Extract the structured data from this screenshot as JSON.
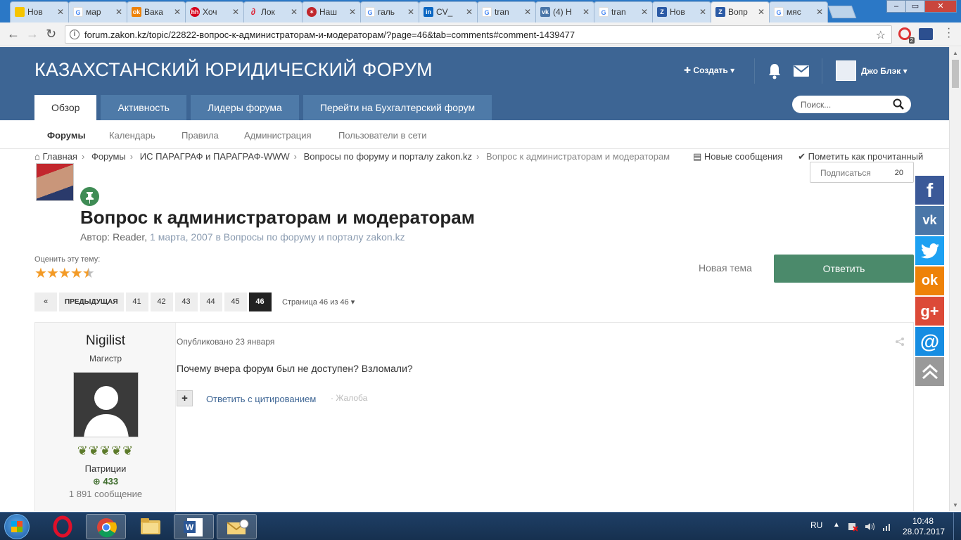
{
  "browser": {
    "tabs": [
      {
        "label": "Нов",
        "icon": "yandex",
        "color": "#f5c400"
      },
      {
        "label": "мар",
        "icon": "google",
        "color": "#4285f4"
      },
      {
        "label": "Вака",
        "icon": "odnoklassniki",
        "color": "#ee8208"
      },
      {
        "label": "Хоч",
        "icon": "hh",
        "color": "#d6001c"
      },
      {
        "label": "Лок",
        "icon": "paperclip",
        "color": "#d23"
      },
      {
        "label": "Наш",
        "icon": "red-circle",
        "color": "#c0262c"
      },
      {
        "label": "галь",
        "icon": "google",
        "color": "#4285f4"
      },
      {
        "label": "CV_",
        "icon": "linkedin",
        "color": "#0a66c2"
      },
      {
        "label": "tran",
        "icon": "google",
        "color": "#4285f4"
      },
      {
        "label": "(4) Н",
        "icon": "vk",
        "color": "#4a76a8"
      },
      {
        "label": "tran",
        "icon": "google",
        "color": "#4285f4"
      },
      {
        "label": "Нов",
        "icon": "zakon",
        "color": "#2b5aa5"
      },
      {
        "label": "Вопр",
        "icon": "zakon",
        "color": "#2b5aa5",
        "active": true
      },
      {
        "label": "мяс",
        "icon": "google",
        "color": "#4285f4"
      }
    ],
    "url": "forum.zakon.kz/topic/22822-вопрос-к-администраторам-и-модераторам/?page=46&tab=comments#comment-1439477",
    "ext_badge": "2"
  },
  "header": {
    "site_title": "КАЗАХСТАНСКИЙ ЮРИДИЧЕСКИЙ ФОРУМ",
    "create_label": "Создать",
    "user_name": "Джо Блэк",
    "search_placeholder": "Поиск..."
  },
  "nav_tabs": [
    "Обзор",
    "Активность",
    "Лидеры форума",
    "Перейти на Бухгалтерский форум"
  ],
  "subnav": [
    "Форумы",
    "Календарь",
    "Правила",
    "Администрация",
    "Пользователи в сети"
  ],
  "breadcrumb": {
    "items": [
      "Главная",
      "Форумы",
      "ИС ПАРАГРАФ и ПАРАГРАФ-WWW",
      "Вопросы по форуму и порталу zakon.kz"
    ],
    "current": "Вопрос к администраторам и модераторам"
  },
  "actions": {
    "new_posts": "Новые сообщения",
    "mark_read": "Пометить как прочитанный",
    "follow_label": "Подписаться",
    "follow_count": "20"
  },
  "topic": {
    "title": "Вопрос к администраторам и модераторам",
    "author_prefix": "Автор:",
    "author": "Reader,",
    "date": "1 марта, 2007",
    "in_word": "в",
    "forum": "Вопросы по форуму и порталу zakon.kz",
    "rate_label": "Оценить эту тему:",
    "rating": 4.5,
    "rating_max": 5,
    "new_topic": "Новая тема",
    "reply": "Ответить"
  },
  "pager": {
    "prev": "ПРЕДЫДУЩАЯ",
    "pages": [
      "41",
      "42",
      "43",
      "44",
      "45",
      "46"
    ],
    "current": "46",
    "info": "Страница 46 из 46"
  },
  "post": {
    "author": "Nigilist",
    "rank": "Магистр",
    "group": "Патриции",
    "reputation": "433",
    "posts": "1 891 сообщение",
    "published": "Опубликовано 23 января",
    "text": "Почему вчера форум был не доступен? Взломали?",
    "quote": "Ответить с цитированием",
    "report": "· Жалоба"
  },
  "social": [
    {
      "name": "facebook",
      "glyph": "f",
      "color": "#3b5998"
    },
    {
      "name": "vkontakte",
      "glyph": "vk",
      "color": "#4a76a8"
    },
    {
      "name": "twitter",
      "glyph": "t",
      "color": "#1da1f2"
    },
    {
      "name": "odnoklassniki",
      "glyph": "ok",
      "color": "#ee8208"
    },
    {
      "name": "google-plus",
      "glyph": "g+",
      "color": "#dc4a38"
    },
    {
      "name": "mail-ru",
      "glyph": "@",
      "color": "#168de2"
    },
    {
      "name": "scroll-top",
      "glyph": "^",
      "color": "#999999"
    }
  ],
  "taskbar": {
    "lang": "RU",
    "time": "10:48",
    "date": "28.07.2017"
  }
}
